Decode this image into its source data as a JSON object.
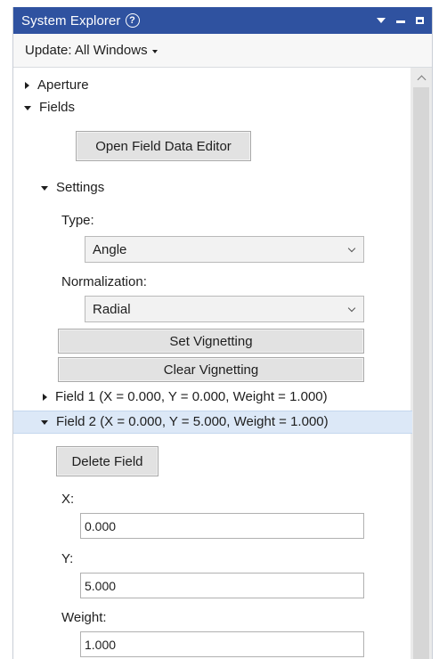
{
  "window": {
    "title": "System Explorer"
  },
  "update": {
    "label": "Update: All Windows"
  },
  "tree": {
    "aperture": "Aperture",
    "fields": "Fields",
    "open_field_data_editor": "Open Field Data Editor",
    "settings": "Settings",
    "type_label": "Type:",
    "type_value": "Angle",
    "normalization_label": "Normalization:",
    "normalization_value": "Radial",
    "set_vignetting": "Set Vignetting",
    "clear_vignetting": "Clear Vignetting",
    "field1": "Field 1 (X = 0.000, Y = 0.000, Weight = 1.000)",
    "field2": "Field 2 (X = 0.000, Y = 5.000, Weight = 1.000)",
    "delete_field": "Delete Field",
    "x_label": "X:",
    "x_value": "0.000",
    "y_label": "Y:",
    "y_value": "5.000",
    "weight_label": "Weight:",
    "weight_value": "1.000"
  },
  "colors": {
    "titlebar": "#2f52a0",
    "selection": "#dce8f7"
  }
}
